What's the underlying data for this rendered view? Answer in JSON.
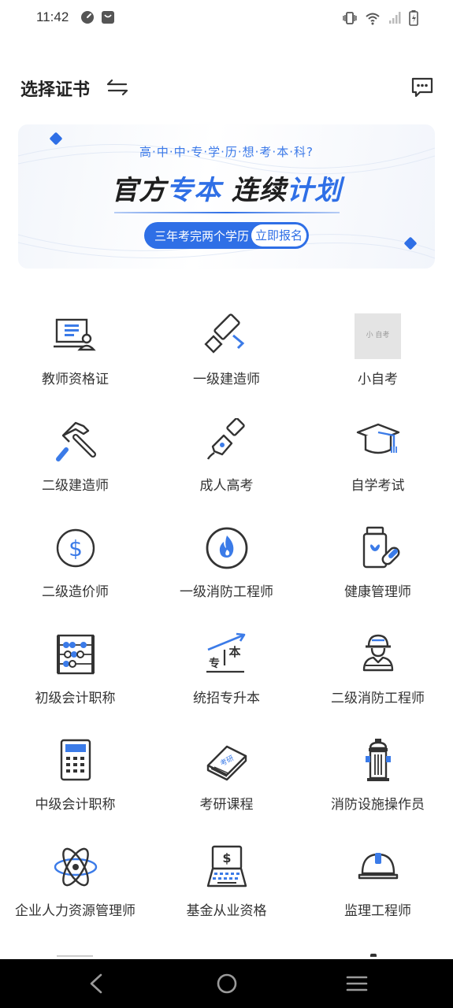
{
  "status_bar": {
    "time": "11:42",
    "left_icons": [
      "clock-badge-icon",
      "bag-icon"
    ],
    "right_icons": [
      "vibrate-icon",
      "wifi-icon",
      "signal-icon",
      "battery-icon"
    ]
  },
  "header": {
    "title": "选择证书",
    "switch_icon": "swap-arrows-icon",
    "message_icon": "message-icon"
  },
  "banner": {
    "subtitle": "高·中·中·专·学·历·想·考·本·科?",
    "main_part1": "官方",
    "main_part2": "专本",
    "main_part3": " 连续",
    "main_part4": "计划",
    "pill_text": "三年考完两个学历",
    "pill_button": "立即报名",
    "accent_color": "#2f6fe6"
  },
  "grid": [
    {
      "label": "教师资格证",
      "icon": "teacher-screen-icon"
    },
    {
      "label": "一级建造师",
      "icon": "paint-roller-icon"
    },
    {
      "label": "小自考",
      "icon": "thumbnail-image",
      "thumb_text": "小 自考"
    },
    {
      "label": "二级建造师",
      "icon": "hammer-icon"
    },
    {
      "label": "成人高考",
      "icon": "fountain-pen-icon"
    },
    {
      "label": "自学考试",
      "icon": "graduation-cap-icon"
    },
    {
      "label": "二级造价师",
      "icon": "dollar-circle-icon"
    },
    {
      "label": "一级消防工程师",
      "icon": "fire-circle-icon"
    },
    {
      "label": "健康管理师",
      "icon": "medicine-bottle-icon"
    },
    {
      "label": "初级会计职称",
      "icon": "abacus-icon"
    },
    {
      "label": "统招专升本",
      "icon": "upgrade-arrow-icon"
    },
    {
      "label": "二级消防工程师",
      "icon": "firefighter-icon"
    },
    {
      "label": "中级会计职称",
      "icon": "calculator-icon"
    },
    {
      "label": "考研课程",
      "icon": "book-icon",
      "book_text": "考研"
    },
    {
      "label": "消防设施操作员",
      "icon": "fire-hydrant-icon"
    },
    {
      "label": "企业人力资源管理师",
      "icon": "atom-icon"
    },
    {
      "label": "基金从业资格",
      "icon": "laptop-dollar-icon",
      "laptop_text": "$"
    },
    {
      "label": "监理工程师",
      "icon": "hard-hat-icon"
    }
  ],
  "nav": {
    "back": "back-triangle-icon",
    "home": "home-circle-icon",
    "menu": "menu-lines-icon"
  }
}
